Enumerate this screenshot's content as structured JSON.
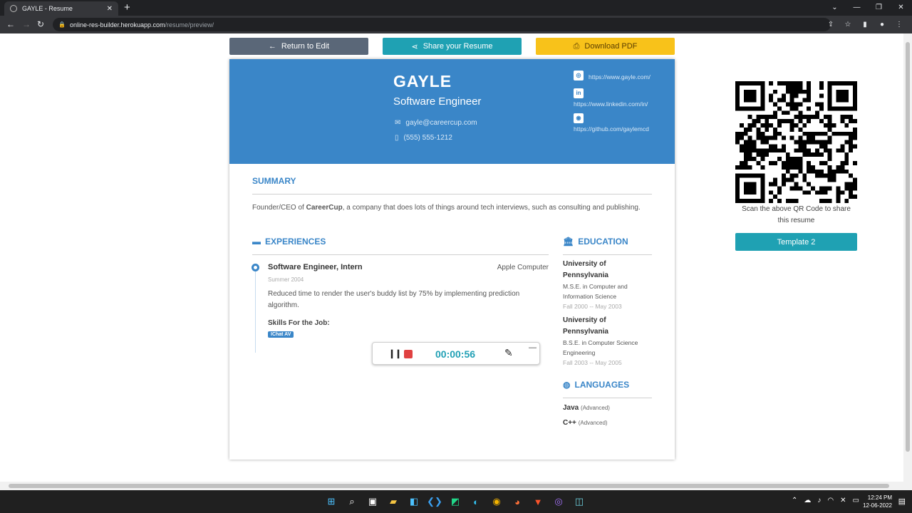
{
  "browser": {
    "tab_title": "GAYLE - Resume",
    "url_host": "online-res-builder.herokuapp.com",
    "url_path": "/resume/preview/"
  },
  "actions": {
    "return_label": "Return to Edit",
    "share_label": "Share your Resume",
    "download_label": "Download PDF"
  },
  "resume": {
    "name": "GAYLE",
    "role": "Software Engineer",
    "email": "gayle@careercup.com",
    "phone": "(555) 555-1212",
    "links": {
      "website": "https://www.gayle.com/",
      "linkedin": "https://www.linkedin.com/in/",
      "github": "https://github.com/gaylemcd"
    },
    "summary": {
      "heading": "SUMMARY",
      "text_before": "Founder/CEO of ",
      "company": "CareerCup",
      "text_after": ", a company that does lots of things around tech interviews, such as consulting and publishing."
    },
    "experiences": {
      "heading": "EXPERIENCES",
      "items": [
        {
          "title": "Software Engineer, Intern",
          "company": "Apple Computer",
          "date": "Summer 2004",
          "description": "Reduced time to render the user's buddy list by 75% by implementing prediction algorithm.",
          "skills_label": "Skills For the Job:",
          "skills": [
            "IChat AV"
          ]
        }
      ]
    },
    "education": {
      "heading": "EDUCATION",
      "items": [
        {
          "school": "University of Pennsylvania",
          "degree": "M.S.E. in Computer and Information Science",
          "date": "Fall 2000 -- May 2003"
        },
        {
          "school": "University of Pennsylvania",
          "degree": "B.S.E. in Computer Science Engineering",
          "date": "Fall 2003 -- May 2005"
        }
      ]
    },
    "languages": {
      "heading": "LANGUAGES",
      "items": [
        {
          "name": "Java",
          "level": "(Advanced)"
        },
        {
          "name": "C++",
          "level": "(Advanced)"
        }
      ]
    }
  },
  "recorder": {
    "time": "00:00:56"
  },
  "sidebar": {
    "qr_caption": "Scan the above QR Code to share this resume",
    "template_label": "Template 2"
  },
  "taskbar": {
    "time": "12:24 PM",
    "date": "12-06-2022"
  },
  "colors": {
    "header_blue": "#3a86c8",
    "teal": "#1fa1b3",
    "yellow": "#f8c21a",
    "slate": "#5a6778"
  }
}
